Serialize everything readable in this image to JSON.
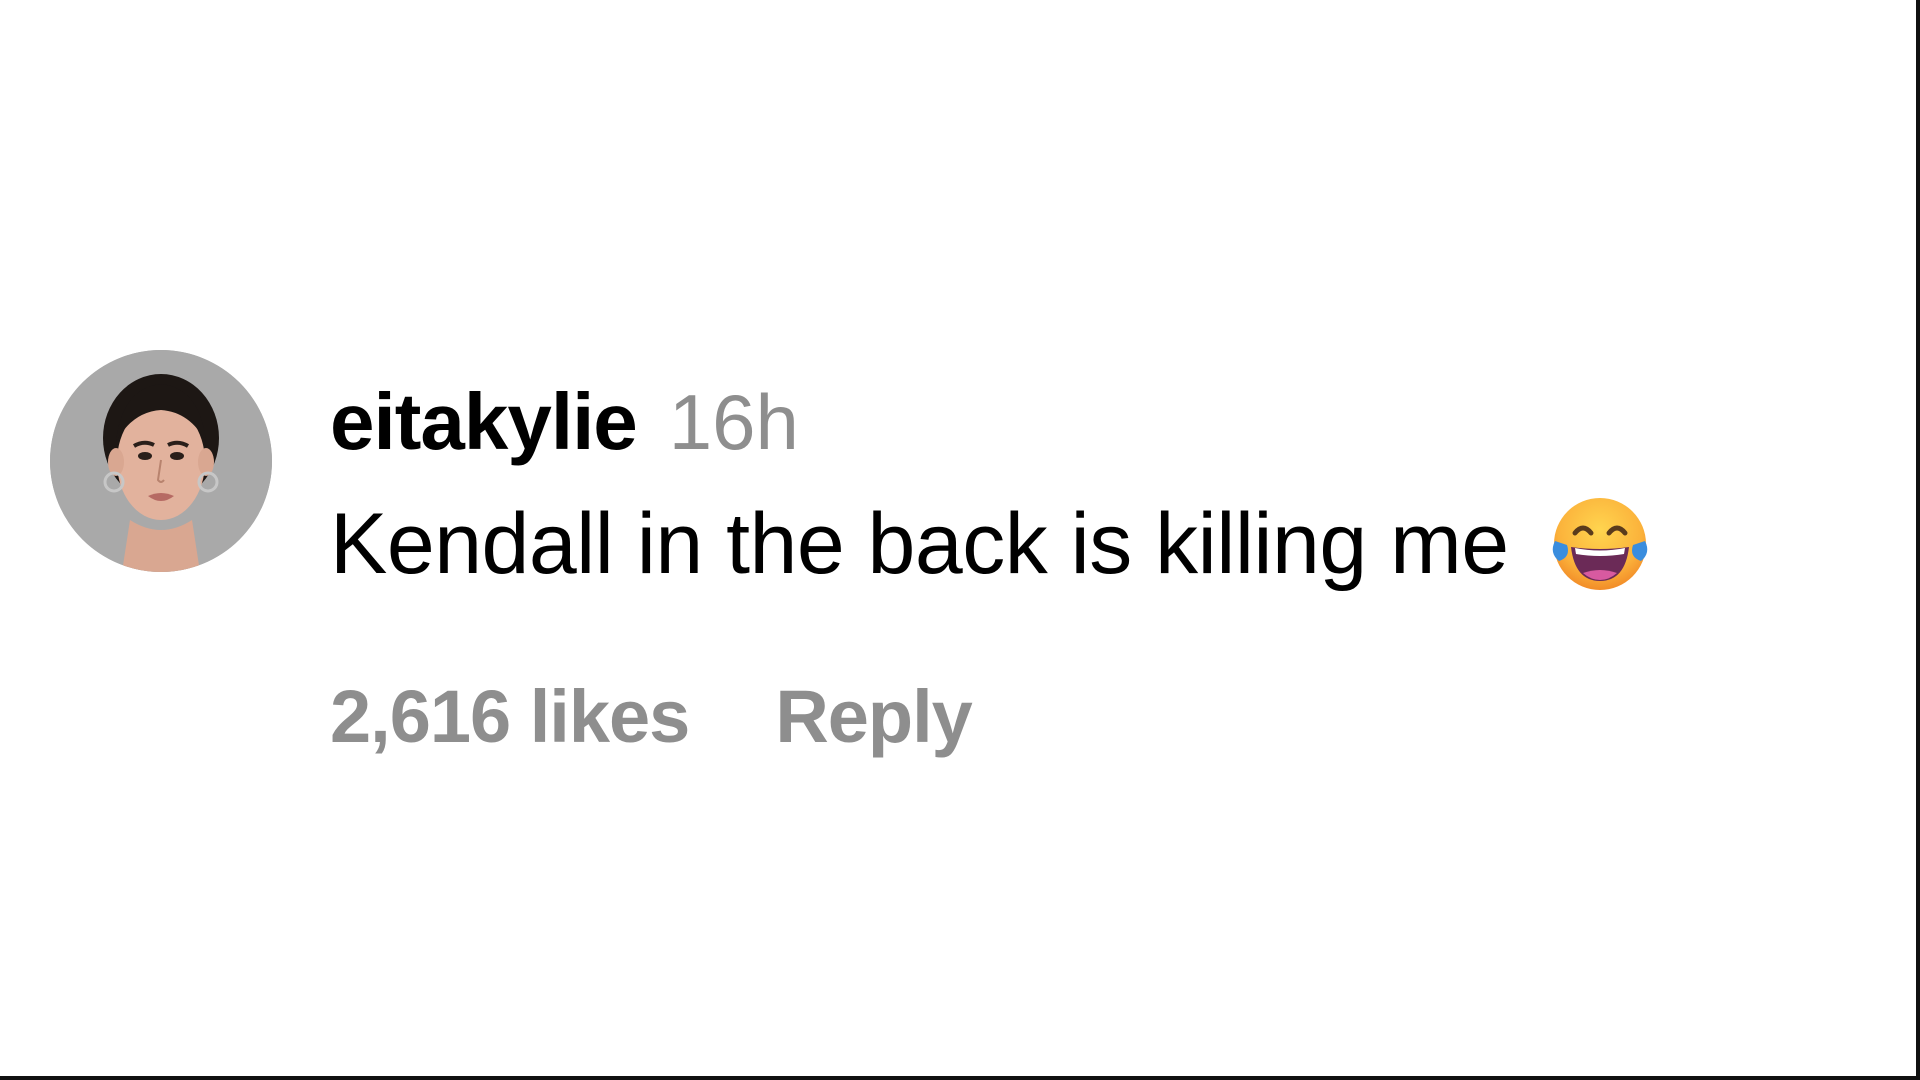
{
  "comment": {
    "avatar_icon": "profile-photo",
    "username": "eitakylie",
    "timestamp": "16h",
    "text": "Kendall in the back is killing me",
    "emoji_icon": "face-with-tears-of-joy-icon",
    "likes": "2,616 likes",
    "reply_label": "Reply"
  },
  "colors": {
    "background": "#ffffff",
    "text_primary": "#000000",
    "text_secondary": "#8e8e8e",
    "avatar_bg": "#a9a9a9"
  }
}
